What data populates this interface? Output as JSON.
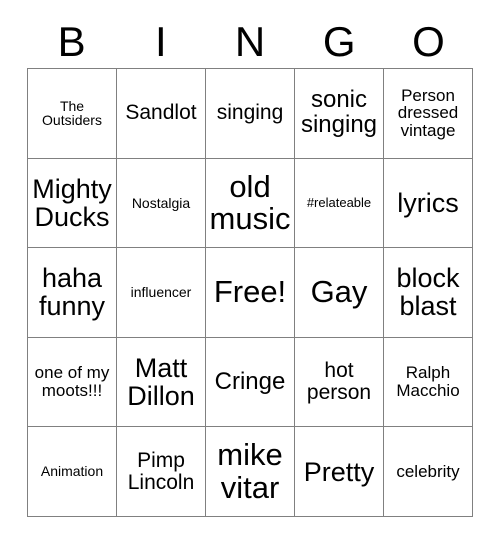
{
  "card": {
    "title": "BINGO",
    "headers": [
      "B",
      "I",
      "N",
      "G",
      "O"
    ],
    "free_space_label": "Free!",
    "grid_border_color": "#808080",
    "text_color": "#000000",
    "background_color": "#ffffff",
    "rows": [
      [
        {
          "text": "The Outsiders",
          "size": "xs"
        },
        {
          "text": "Sandlot",
          "size": "md"
        },
        {
          "text": "singing",
          "size": "md"
        },
        {
          "text": "sonic singing",
          "size": "lg"
        },
        {
          "text": "Person dressed vintage",
          "size": "sm"
        }
      ],
      [
        {
          "text": "Mighty Ducks",
          "size": "xl"
        },
        {
          "text": "Nostalgia",
          "size": "xs"
        },
        {
          "text": "old music",
          "size": "xxl"
        },
        {
          "text": "#relateable",
          "size": "xxs"
        },
        {
          "text": "lyrics",
          "size": "xl"
        }
      ],
      [
        {
          "text": "haha funny",
          "size": "xl"
        },
        {
          "text": "influencer",
          "size": "xs"
        },
        {
          "text": "Free!",
          "size": "xxl"
        },
        {
          "text": "Gay",
          "size": "xxl"
        },
        {
          "text": "block blast",
          "size": "xl"
        }
      ],
      [
        {
          "text": "one of my moots!!!",
          "size": "sm"
        },
        {
          "text": "Matt Dillon",
          "size": "xl"
        },
        {
          "text": "Cringe",
          "size": "lg"
        },
        {
          "text": "hot person",
          "size": "md"
        },
        {
          "text": "Ralph Macchio",
          "size": "sm"
        }
      ],
      [
        {
          "text": "Animation",
          "size": "xs"
        },
        {
          "text": "Pimp Lincoln",
          "size": "md"
        },
        {
          "text": "mike vitar",
          "size": "xxl"
        },
        {
          "text": "Pretty",
          "size": "xl"
        },
        {
          "text": "celebrity",
          "size": "sm"
        }
      ]
    ]
  }
}
